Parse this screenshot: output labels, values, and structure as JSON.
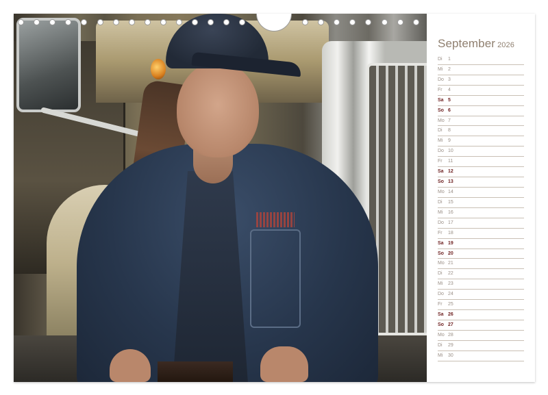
{
  "calendar": {
    "month": "September",
    "year": "2026",
    "days": [
      {
        "weekday": "Di",
        "day": "1",
        "weekend": false
      },
      {
        "weekday": "Mi",
        "day": "2",
        "weekend": false
      },
      {
        "weekday": "Do",
        "day": "3",
        "weekend": false
      },
      {
        "weekday": "Fr",
        "day": "4",
        "weekend": false
      },
      {
        "weekday": "Sa",
        "day": "5",
        "weekend": true
      },
      {
        "weekday": "So",
        "day": "6",
        "weekend": true
      },
      {
        "weekday": "Mo",
        "day": "7",
        "weekend": false
      },
      {
        "weekday": "Di",
        "day": "8",
        "weekend": false
      },
      {
        "weekday": "Mi",
        "day": "9",
        "weekend": false
      },
      {
        "weekday": "Do",
        "day": "10",
        "weekend": false
      },
      {
        "weekday": "Fr",
        "day": "11",
        "weekend": false
      },
      {
        "weekday": "Sa",
        "day": "12",
        "weekend": true
      },
      {
        "weekday": "So",
        "day": "13",
        "weekend": true
      },
      {
        "weekday": "Mo",
        "day": "14",
        "weekend": false
      },
      {
        "weekday": "Di",
        "day": "15",
        "weekend": false
      },
      {
        "weekday": "Mi",
        "day": "16",
        "weekend": false
      },
      {
        "weekday": "Do",
        "day": "17",
        "weekend": false
      },
      {
        "weekday": "Fr",
        "day": "18",
        "weekend": false
      },
      {
        "weekday": "Sa",
        "day": "19",
        "weekend": true
      },
      {
        "weekday": "So",
        "day": "20",
        "weekend": true
      },
      {
        "weekday": "Mo",
        "day": "21",
        "weekend": false
      },
      {
        "weekday": "Di",
        "day": "22",
        "weekend": false
      },
      {
        "weekday": "Mi",
        "day": "23",
        "weekend": false
      },
      {
        "weekday": "Do",
        "day": "24",
        "weekend": false
      },
      {
        "weekday": "Fr",
        "day": "25",
        "weekend": false
      },
      {
        "weekday": "Sa",
        "day": "26",
        "weekend": true
      },
      {
        "weekday": "So",
        "day": "27",
        "weekend": true
      },
      {
        "weekday": "Mo",
        "day": "28",
        "weekend": false
      },
      {
        "weekday": "Di",
        "day": "29",
        "weekend": false
      },
      {
        "weekday": "Mi",
        "day": "30",
        "weekend": false
      }
    ]
  },
  "colors": {
    "title": "#8f7f6f",
    "weekday_text": "#9a8f86",
    "weekend_text": "#6d1f1f",
    "rule": "#c9bfb4"
  },
  "photo": {
    "subject": "photo-woman-truck-driver"
  }
}
